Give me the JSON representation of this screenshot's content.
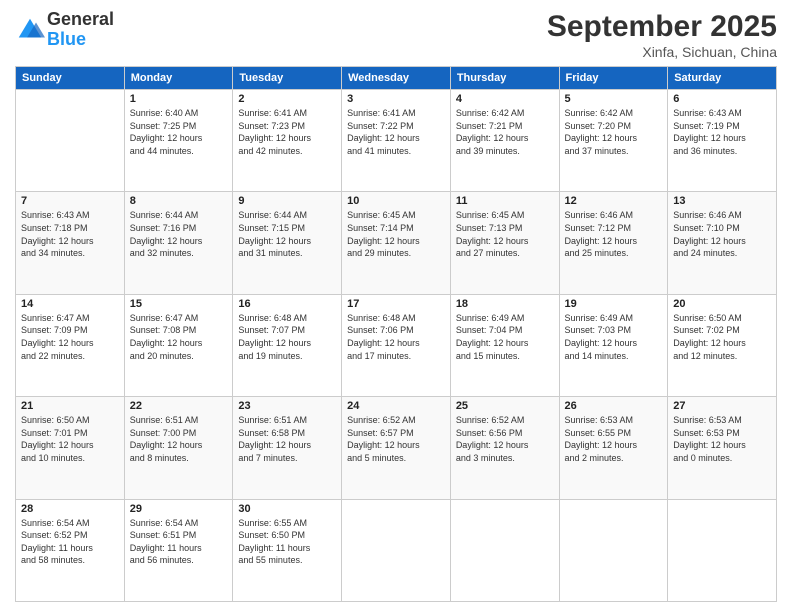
{
  "logo": {
    "general": "General",
    "blue": "Blue"
  },
  "header": {
    "month": "September 2025",
    "location": "Xinfa, Sichuan, China"
  },
  "days_of_week": [
    "Sunday",
    "Monday",
    "Tuesday",
    "Wednesday",
    "Thursday",
    "Friday",
    "Saturday"
  ],
  "weeks": [
    [
      {
        "day": "",
        "info": ""
      },
      {
        "day": "1",
        "info": "Sunrise: 6:40 AM\nSunset: 7:25 PM\nDaylight: 12 hours\nand 44 minutes."
      },
      {
        "day": "2",
        "info": "Sunrise: 6:41 AM\nSunset: 7:23 PM\nDaylight: 12 hours\nand 42 minutes."
      },
      {
        "day": "3",
        "info": "Sunrise: 6:41 AM\nSunset: 7:22 PM\nDaylight: 12 hours\nand 41 minutes."
      },
      {
        "day": "4",
        "info": "Sunrise: 6:42 AM\nSunset: 7:21 PM\nDaylight: 12 hours\nand 39 minutes."
      },
      {
        "day": "5",
        "info": "Sunrise: 6:42 AM\nSunset: 7:20 PM\nDaylight: 12 hours\nand 37 minutes."
      },
      {
        "day": "6",
        "info": "Sunrise: 6:43 AM\nSunset: 7:19 PM\nDaylight: 12 hours\nand 36 minutes."
      }
    ],
    [
      {
        "day": "7",
        "info": "Sunrise: 6:43 AM\nSunset: 7:18 PM\nDaylight: 12 hours\nand 34 minutes."
      },
      {
        "day": "8",
        "info": "Sunrise: 6:44 AM\nSunset: 7:16 PM\nDaylight: 12 hours\nand 32 minutes."
      },
      {
        "day": "9",
        "info": "Sunrise: 6:44 AM\nSunset: 7:15 PM\nDaylight: 12 hours\nand 31 minutes."
      },
      {
        "day": "10",
        "info": "Sunrise: 6:45 AM\nSunset: 7:14 PM\nDaylight: 12 hours\nand 29 minutes."
      },
      {
        "day": "11",
        "info": "Sunrise: 6:45 AM\nSunset: 7:13 PM\nDaylight: 12 hours\nand 27 minutes."
      },
      {
        "day": "12",
        "info": "Sunrise: 6:46 AM\nSunset: 7:12 PM\nDaylight: 12 hours\nand 25 minutes."
      },
      {
        "day": "13",
        "info": "Sunrise: 6:46 AM\nSunset: 7:10 PM\nDaylight: 12 hours\nand 24 minutes."
      }
    ],
    [
      {
        "day": "14",
        "info": "Sunrise: 6:47 AM\nSunset: 7:09 PM\nDaylight: 12 hours\nand 22 minutes."
      },
      {
        "day": "15",
        "info": "Sunrise: 6:47 AM\nSunset: 7:08 PM\nDaylight: 12 hours\nand 20 minutes."
      },
      {
        "day": "16",
        "info": "Sunrise: 6:48 AM\nSunset: 7:07 PM\nDaylight: 12 hours\nand 19 minutes."
      },
      {
        "day": "17",
        "info": "Sunrise: 6:48 AM\nSunset: 7:06 PM\nDaylight: 12 hours\nand 17 minutes."
      },
      {
        "day": "18",
        "info": "Sunrise: 6:49 AM\nSunset: 7:04 PM\nDaylight: 12 hours\nand 15 minutes."
      },
      {
        "day": "19",
        "info": "Sunrise: 6:49 AM\nSunset: 7:03 PM\nDaylight: 12 hours\nand 14 minutes."
      },
      {
        "day": "20",
        "info": "Sunrise: 6:50 AM\nSunset: 7:02 PM\nDaylight: 12 hours\nand 12 minutes."
      }
    ],
    [
      {
        "day": "21",
        "info": "Sunrise: 6:50 AM\nSunset: 7:01 PM\nDaylight: 12 hours\nand 10 minutes."
      },
      {
        "day": "22",
        "info": "Sunrise: 6:51 AM\nSunset: 7:00 PM\nDaylight: 12 hours\nand 8 minutes."
      },
      {
        "day": "23",
        "info": "Sunrise: 6:51 AM\nSunset: 6:58 PM\nDaylight: 12 hours\nand 7 minutes."
      },
      {
        "day": "24",
        "info": "Sunrise: 6:52 AM\nSunset: 6:57 PM\nDaylight: 12 hours\nand 5 minutes."
      },
      {
        "day": "25",
        "info": "Sunrise: 6:52 AM\nSunset: 6:56 PM\nDaylight: 12 hours\nand 3 minutes."
      },
      {
        "day": "26",
        "info": "Sunrise: 6:53 AM\nSunset: 6:55 PM\nDaylight: 12 hours\nand 2 minutes."
      },
      {
        "day": "27",
        "info": "Sunrise: 6:53 AM\nSunset: 6:53 PM\nDaylight: 12 hours\nand 0 minutes."
      }
    ],
    [
      {
        "day": "28",
        "info": "Sunrise: 6:54 AM\nSunset: 6:52 PM\nDaylight: 11 hours\nand 58 minutes."
      },
      {
        "day": "29",
        "info": "Sunrise: 6:54 AM\nSunset: 6:51 PM\nDaylight: 11 hours\nand 56 minutes."
      },
      {
        "day": "30",
        "info": "Sunrise: 6:55 AM\nSunset: 6:50 PM\nDaylight: 11 hours\nand 55 minutes."
      },
      {
        "day": "",
        "info": ""
      },
      {
        "day": "",
        "info": ""
      },
      {
        "day": "",
        "info": ""
      },
      {
        "day": "",
        "info": ""
      }
    ]
  ]
}
